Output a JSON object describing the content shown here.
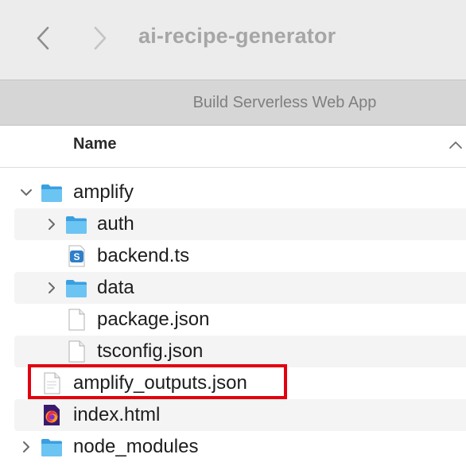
{
  "window": {
    "title": "ai-recipe-generator",
    "tab": "Build Serverless Web App"
  },
  "toolbar": {
    "back_icon": "chevron-left-icon",
    "forward_icon": "chevron-right-icon"
  },
  "column_header": {
    "name": "Name",
    "sort_icon": "chevron-up-icon"
  },
  "files": [
    {
      "name": "amplify",
      "type": "folder",
      "depth": 0,
      "expanded": true
    },
    {
      "name": "auth",
      "type": "folder",
      "depth": 1,
      "expanded": false
    },
    {
      "name": "backend.ts",
      "type": "typescript-file",
      "depth": 1
    },
    {
      "name": "data",
      "type": "folder",
      "depth": 1,
      "expanded": false
    },
    {
      "name": "package.json",
      "type": "document",
      "depth": 1
    },
    {
      "name": "tsconfig.json",
      "type": "document",
      "depth": 1
    },
    {
      "name": "amplify_outputs.json",
      "type": "document",
      "depth": 0,
      "highlighted": true
    },
    {
      "name": "index.html",
      "type": "html-file",
      "depth": 0
    },
    {
      "name": "node_modules",
      "type": "folder",
      "depth": 0,
      "expanded": false
    }
  ],
  "colors": {
    "folder": "#5ab6ec",
    "highlight": "#e3000f",
    "stripe": "#f4f4f4"
  }
}
